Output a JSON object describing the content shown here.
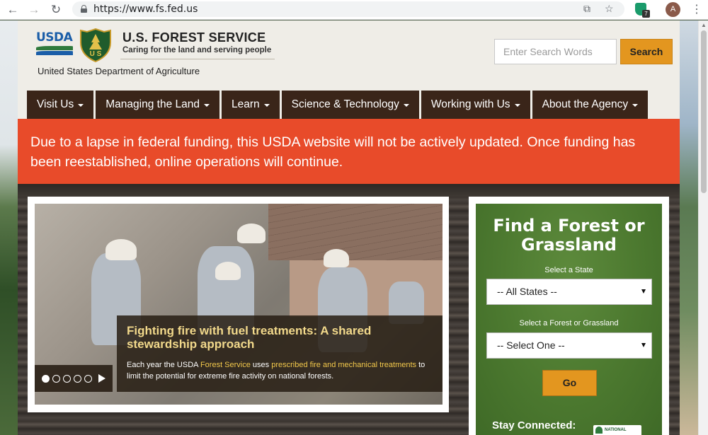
{
  "browser": {
    "url": "https://www.fs.fed.us",
    "extension_badge": "7",
    "profile_initial": "A"
  },
  "header": {
    "usda_logo_text": "USDA",
    "shield_text": "U S",
    "title": "U.S. FOREST SERVICE",
    "tagline": "Caring for the land and serving people",
    "department": "United States Department of Agriculture",
    "search_placeholder": "Enter Search Words",
    "search_button": "Search"
  },
  "nav": {
    "items": [
      {
        "label": "Visit Us"
      },
      {
        "label": "Managing the Land"
      },
      {
        "label": "Learn"
      },
      {
        "label": "Science & Technology"
      },
      {
        "label": "Working with Us"
      },
      {
        "label": "About the Agency"
      }
    ]
  },
  "alert": {
    "text": "Due to a lapse in federal funding, this USDA website will not be actively updated. Once funding has been reestablished, online operations will continue."
  },
  "slider": {
    "title": "Fighting fire with fuel treatments: A shared stewardship approach",
    "body_prefix": "Each year the USDA ",
    "body_link1": "Forest Service",
    "body_mid": " uses ",
    "body_link2": "prescribed fire and mechanical treatments",
    "body_suffix": " to limit the potential for extreme fire activity on national forests.",
    "slide_count": 5,
    "active_slide": 1
  },
  "find_forest": {
    "title": "Find a Forest or Grassland",
    "state_label": "Select a State",
    "state_value": "-- All States --",
    "forest_label": "Select a Forest or Grassland",
    "forest_value": "-- Select One --",
    "go_button": "Go",
    "stay_connected": "Stay Connected:",
    "badge_text": "NATIONAL"
  },
  "colors": {
    "alert_bg": "#e84b2a",
    "nav_bg": "#3a2519",
    "accent_orange": "#e3961f",
    "panel_green": "#4d7a30",
    "caption_title": "#f2d98b"
  }
}
